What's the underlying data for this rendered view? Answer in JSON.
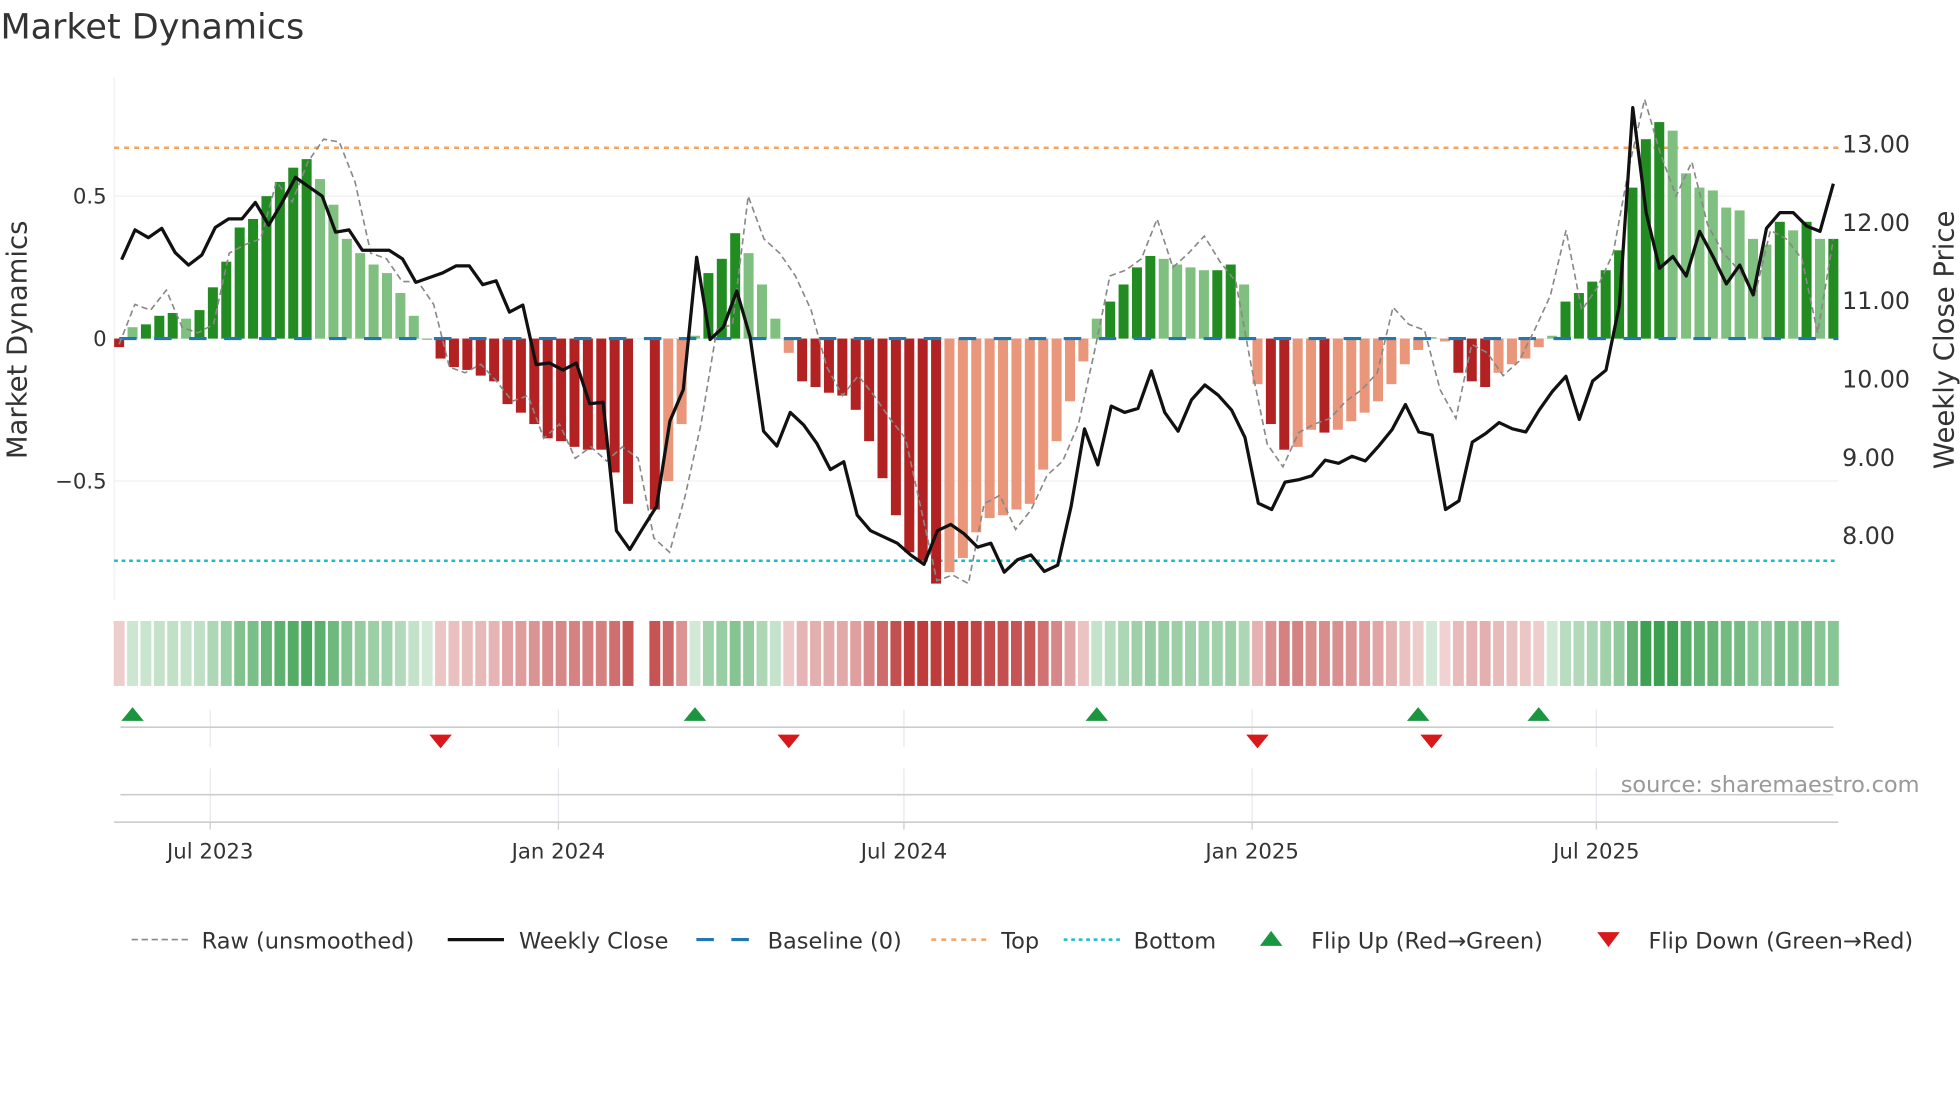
{
  "chart_data": {
    "type": "bar",
    "title": "Market Dynamics",
    "ylabel": "Market Dynamics",
    "y2label": "Weekly Close Price",
    "ylim": [
      -0.92,
      0.9
    ],
    "y2lim": [
      7.2,
      13.8
    ],
    "y_ticks": [
      {
        "label": "0.5",
        "value": 0.5
      },
      {
        "label": "0",
        "value": 0
      },
      {
        "label": "−0.5",
        "value": -0.5
      }
    ],
    "y2_ticks": [
      {
        "label": "13.00",
        "value": 13
      },
      {
        "label": "12.00",
        "value": 12
      },
      {
        "label": "11.00",
        "value": 11
      },
      {
        "label": "10.00",
        "value": 10
      },
      {
        "label": "9.00",
        "value": 9
      },
      {
        "label": "8.00",
        "value": 8
      }
    ],
    "x_ticks": [
      {
        "label": "Jul 2023",
        "week": 6.8
      },
      {
        "label": "Jan 2024",
        "week": 32.8
      },
      {
        "label": "Jul 2024",
        "week": 58.6
      },
      {
        "label": "Jan 2025",
        "week": 84.6
      },
      {
        "label": "Jul 2025",
        "week": 110.3
      }
    ],
    "top_level": 0.67,
    "bottom_level": -0.78,
    "baseline": 0,
    "bars": [
      -0.03,
      0.04,
      0.05,
      0.08,
      0.09,
      0.07,
      0.1,
      0.18,
      0.27,
      0.39,
      0.42,
      0.5,
      0.55,
      0.6,
      0.63,
      0.56,
      0.47,
      0.35,
      0.3,
      0.26,
      0.23,
      0.16,
      0.08,
      0.0,
      -0.07,
      -0.1,
      -0.11,
      -0.13,
      -0.15,
      -0.23,
      -0.26,
      -0.3,
      -0.35,
      -0.36,
      -0.38,
      -0.39,
      -0.39,
      -0.47,
      -0.58,
      null,
      -0.6,
      -0.5,
      -0.3,
      0.01,
      0.23,
      0.28,
      0.37,
      0.3,
      0.19,
      0.07,
      -0.05,
      -0.15,
      -0.17,
      -0.19,
      -0.2,
      -0.25,
      -0.36,
      -0.49,
      -0.62,
      -0.75,
      -0.78,
      -0.86,
      -0.82,
      -0.77,
      -0.68,
      -0.63,
      -0.62,
      -0.6,
      -0.58,
      -0.46,
      -0.36,
      -0.22,
      -0.08,
      0.07,
      0.13,
      0.19,
      0.25,
      0.29,
      0.28,
      0.26,
      0.25,
      0.24,
      0.24,
      0.26,
      0.19,
      -0.16,
      -0.3,
      -0.39,
      -0.38,
      -0.32,
      -0.33,
      -0.32,
      -0.29,
      -0.26,
      -0.22,
      -0.16,
      -0.09,
      -0.04,
      0.005,
      -0.01,
      -0.12,
      -0.15,
      -0.17,
      -0.12,
      -0.09,
      -0.07,
      -0.03,
      0.01,
      0.13,
      0.16,
      0.2,
      0.24,
      0.31,
      0.53,
      0.7,
      0.76,
      0.73,
      0.58,
      0.53,
      0.52,
      0.46,
      0.45,
      0.35,
      0.33,
      0.41,
      0.38,
      0.41,
      0.35,
      0.35
    ],
    "raw": [
      -0.02,
      0.12,
      0.1,
      0.17,
      0.04,
      0.02,
      0.05,
      0.3,
      0.33,
      0.35,
      0.55,
      0.48,
      0.62,
      0.7,
      0.69,
      0.55,
      0.3,
      0.28,
      0.2,
      0.2,
      0.12,
      -0.1,
      -0.12,
      -0.09,
      -0.15,
      -0.22,
      -0.2,
      -0.35,
      -0.3,
      -0.42,
      -0.38,
      -0.43,
      -0.38,
      -0.42,
      -0.7,
      -0.75,
      -0.55,
      -0.3,
      0.03,
      0.05,
      0.5,
      0.35,
      0.3,
      0.22,
      0.1,
      -0.1,
      -0.2,
      -0.13,
      -0.2,
      -0.28,
      -0.35,
      -0.6,
      -0.85,
      -0.83,
      -0.86,
      -0.58,
      -0.55,
      -0.67,
      -0.6,
      -0.48,
      -0.43,
      -0.3,
      -0.05,
      0.22,
      0.24,
      0.28,
      0.42,
      0.25,
      0.3,
      0.36,
      0.27,
      0.2,
      -0.1,
      -0.37,
      -0.45,
      -0.33,
      -0.3,
      -0.28,
      -0.22,
      -0.18,
      -0.12,
      0.11,
      0.05,
      0.03,
      -0.18,
      -0.28,
      -0.02,
      -0.05,
      -0.13,
      -0.08,
      0.03,
      0.15,
      0.38,
      0.1,
      0.18,
      0.3,
      0.6,
      0.84,
      0.65,
      0.5,
      0.62,
      0.4,
      0.3,
      0.24,
      0.15,
      0.38,
      0.35,
      0.28,
      0.02,
      0.35
    ],
    "close": [
      11.52,
      11.9,
      11.8,
      11.92,
      11.61,
      11.45,
      11.58,
      11.93,
      12.04,
      12.04,
      12.25,
      11.96,
      12.25,
      12.57,
      12.45,
      12.33,
      11.87,
      11.9,
      11.64,
      11.64,
      11.64,
      11.53,
      11.23,
      11.29,
      11.35,
      11.44,
      11.44,
      11.2,
      11.25,
      10.85,
      10.94,
      10.18,
      10.2,
      10.11,
      10.2,
      9.68,
      9.7,
      8.06,
      7.82,
      8.1,
      8.37,
      9.46,
      9.86,
      11.55,
      10.5,
      10.66,
      11.12,
      10.53,
      9.33,
      9.14,
      9.57,
      9.41,
      9.17,
      8.84,
      8.94,
      8.26,
      8.06,
      7.98,
      7.9,
      7.75,
      7.63,
      8.06,
      8.14,
      8.02,
      7.85,
      7.9,
      7.53,
      7.69,
      7.75,
      7.54,
      7.62,
      8.37,
      9.36,
      8.9,
      9.65,
      9.57,
      9.62,
      10.1,
      9.57,
      9.33,
      9.73,
      9.92,
      9.79,
      9.6,
      9.25,
      8.41,
      8.33,
      8.68,
      8.71,
      8.76,
      8.96,
      8.92,
      9.01,
      8.95,
      9.14,
      9.35,
      9.67,
      9.32,
      9.28,
      8.33,
      8.44,
      9.19,
      9.3,
      9.44,
      9.36,
      9.32,
      9.6,
      9.84,
      10.03,
      9.48,
      9.97,
      10.11,
      10.94,
      13.46,
      12.12,
      11.41,
      11.56,
      11.31,
      11.88,
      11.56,
      11.21,
      11.45,
      11.07,
      11.92,
      12.12,
      12.12,
      11.95,
      11.88,
      12.49
    ],
    "flip_up_weeks": [
      1,
      43,
      73,
      97,
      106
    ],
    "flip_down_weeks": [
      24,
      50,
      85,
      98
    ],
    "colors": {
      "green_dark": "#228b22",
      "green_light": "#7fbf7f",
      "red_dark": "#b22222",
      "red_light": "#e9967a",
      "top": "#f4a460",
      "bottom": "#17becf",
      "baseline": "#1f77b4",
      "up": "#1a9641",
      "down": "#d7191c"
    },
    "legend": [
      {
        "label": "Raw (unsmoothed)"
      },
      {
        "label": "Weekly Close"
      },
      {
        "label": "Baseline (0)"
      },
      {
        "label": "Top"
      },
      {
        "label": "Bottom"
      },
      {
        "label": "Flip Up (Red→Green)"
      },
      {
        "label": "Flip Down (Green→Red)"
      }
    ],
    "legend_position": "bottom",
    "source": "source: sharemaestro.com"
  }
}
